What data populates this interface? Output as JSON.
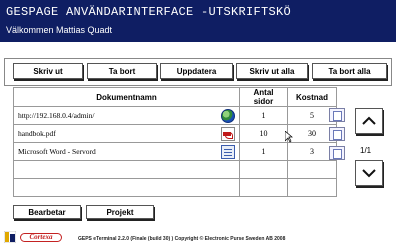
{
  "header": {
    "title": "GESPAGE ANVÄNDARINTERFACE -UTSKRIFTSKÖ",
    "welcome": "Välkommen Mattias Quadt"
  },
  "toolbar": {
    "print": "Skriv ut",
    "delete": "Ta bort",
    "refresh": "Uppdatera",
    "print_all": "Skriv ut alla",
    "delete_all": "Ta bort alla"
  },
  "table": {
    "columns": [
      "Dokumentnamn",
      "Antal sidor",
      "Kostnad"
    ],
    "rows": [
      {
        "name": "http://192.168.0.4/admin/",
        "pages": "1",
        "cost": "5",
        "icon": "globe-icon"
      },
      {
        "name": "handbok.pdf",
        "pages": "10",
        "cost": "30",
        "icon": "pdf-icon"
      },
      {
        "name": "Microsoft Word - Servord",
        "pages": "1",
        "cost": "3",
        "icon": "word-document-icon"
      }
    ]
  },
  "pagination": {
    "page": "1/1"
  },
  "tabs": {
    "processing": "Bearbetar",
    "projects": "Projekt"
  },
  "footer": {
    "logo_text": "Cortexa",
    "copyright": "GEPS eTerminal 2.2.0 (Finale (build 30) ) Copyright © Electronic Purse Sweden AB 2008"
  },
  "colors": {
    "header_bg": "#0f1e63",
    "header_text": "#ffffff"
  }
}
